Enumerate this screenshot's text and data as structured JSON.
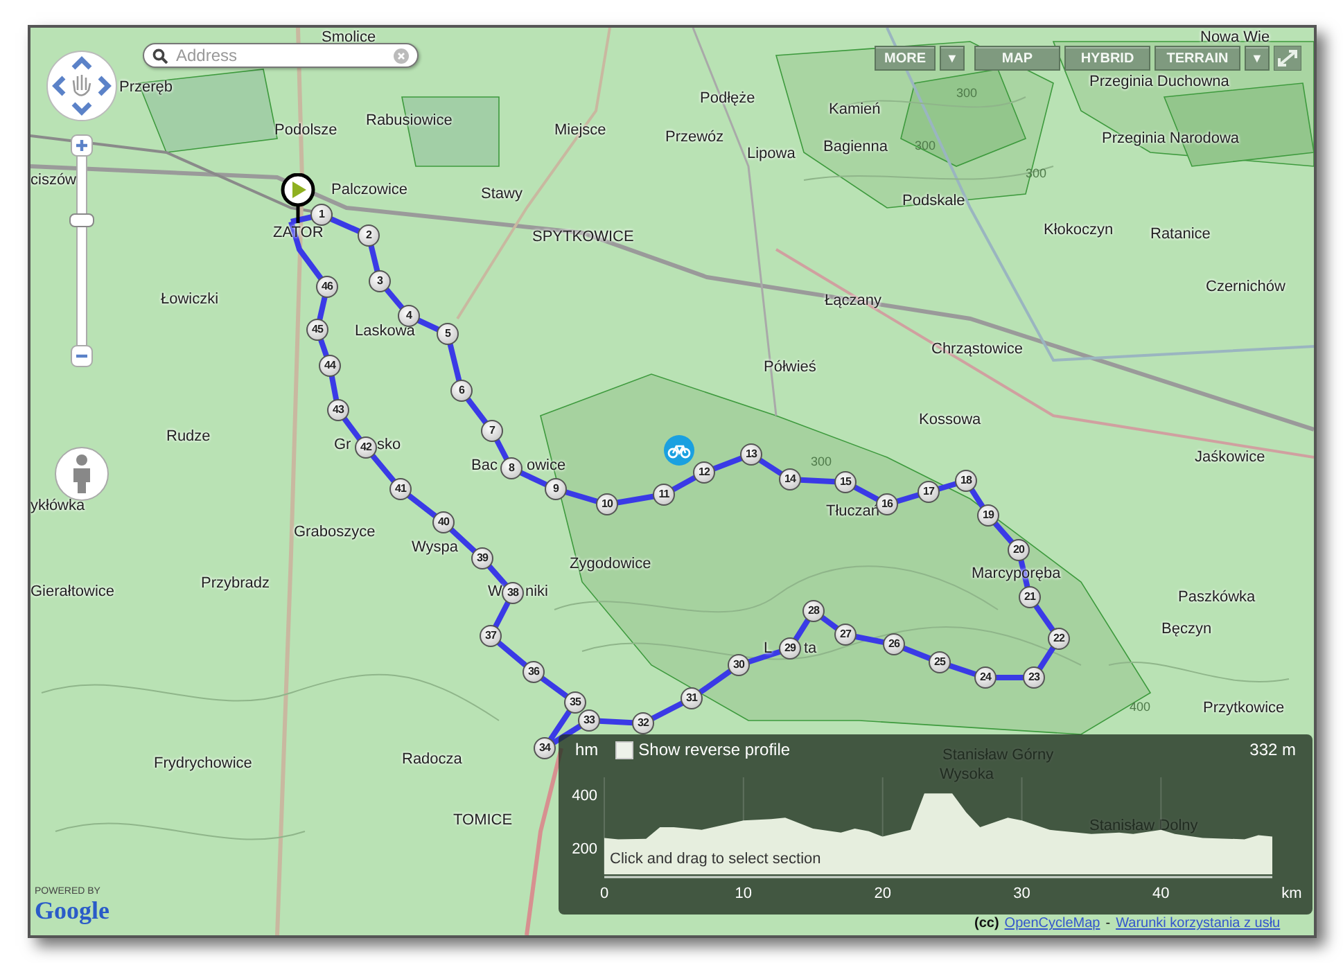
{
  "search": {
    "placeholder": "Address"
  },
  "zoom_slider": {
    "level": 0.68
  },
  "map_types": [
    {
      "label": "MORE",
      "kind": "button",
      "selected": false
    },
    {
      "label": "▼",
      "kind": "dropdown",
      "selected": false
    },
    {
      "label": "MAP",
      "kind": "button",
      "selected": false
    },
    {
      "label": "HYBRID",
      "kind": "button",
      "selected": false
    },
    {
      "label": "TERRAIN",
      "kind": "button",
      "selected": false
    },
    {
      "label": "▼",
      "kind": "dropdown",
      "selected": false
    }
  ],
  "place_labels": [
    "Smolice",
    "Przeręb",
    "Podolsze",
    "Rabusiowice",
    "Miejsce",
    "Podłęże",
    "Przewóz",
    "Kamień",
    "Bagienna",
    "Lipowa",
    "Przeginia Duchowna",
    "Przeginia Narodowa",
    "Podskale",
    "Kłokoczyn",
    "Ratanice",
    "Czernichów",
    "ciszów",
    "Palczowice",
    "Stawy",
    "ZATOR",
    "SPYTKOWICE",
    "Łowiczki",
    "Łączany",
    "Chrząstowice",
    "Półwieś",
    "Laskowa",
    "Kossowa",
    "Jaśkowice",
    "Rudze",
    "Gr",
    "sko",
    "Bac",
    "owice",
    "Tłuczań",
    "Marcyporęba",
    "Zygodowice",
    "Graboszyce",
    "Wyspa",
    "W",
    "niki",
    "ykłówka",
    "Przybradz",
    "Gierałtowice",
    "Paszkówka",
    "Bęczyn",
    "L",
    "ta",
    "Przytkowice",
    "Frydrychowice",
    "Radocza",
    "TOMICE",
    "Nowa Wie",
    "Stanisław Górny",
    "Wysoka",
    "Stanisław Dolny"
  ],
  "contour_labels": [
    "300",
    "300",
    "300",
    "300",
    "400"
  ],
  "waypoints": [
    "1",
    "2",
    "3",
    "4",
    "5",
    "6",
    "7",
    "8",
    "9",
    "10",
    "11",
    "12",
    "13",
    "14",
    "15",
    "16",
    "17",
    "18",
    "19",
    "20",
    "21",
    "22",
    "23",
    "24",
    "25",
    "26",
    "27",
    "28",
    "29",
    "30",
    "31",
    "32",
    "33",
    "34",
    "35",
    "36",
    "37",
    "38",
    "39",
    "40",
    "41",
    "42",
    "43",
    "44",
    "45",
    "46"
  ],
  "elevation": {
    "reverse_profile": {
      "label": "Show reverse profile",
      "checked": false
    },
    "reading": "332 m",
    "hint": "Click and drag to select section",
    "chart_data": {
      "type": "area",
      "xlabel": "km",
      "ylabel": "hm",
      "grid": true,
      "xlim": [
        0,
        48
      ],
      "ylim": [
        100,
        460
      ],
      "xticks": [
        0,
        10,
        20,
        30,
        40
      ],
      "yticks": [
        200,
        400
      ],
      "x": [
        0,
        1,
        3,
        4,
        5,
        7,
        10,
        12,
        13,
        15,
        17,
        18,
        19,
        20,
        22,
        23,
        25,
        26,
        27,
        29,
        30,
        32,
        35,
        37,
        38,
        40,
        41,
        43,
        46,
        47,
        48
      ],
      "series": [
        {
          "color": "#e6eede",
          "values": [
            235,
            230,
            232,
            275,
            275,
            265,
            300,
            305,
            310,
            270,
            255,
            270,
            260,
            240,
            265,
            400,
            400,
            330,
            275,
            310,
            300,
            265,
            250,
            255,
            250,
            265,
            250,
            235,
            230,
            245,
            240
          ]
        }
      ]
    }
  },
  "logo": {
    "caption": "POWERED BY",
    "name": "Google"
  },
  "attribution": {
    "license": "(cc)",
    "link": "OpenCycleMap",
    "separator": "-",
    "terms": "Warunki korzystania z usłu"
  }
}
